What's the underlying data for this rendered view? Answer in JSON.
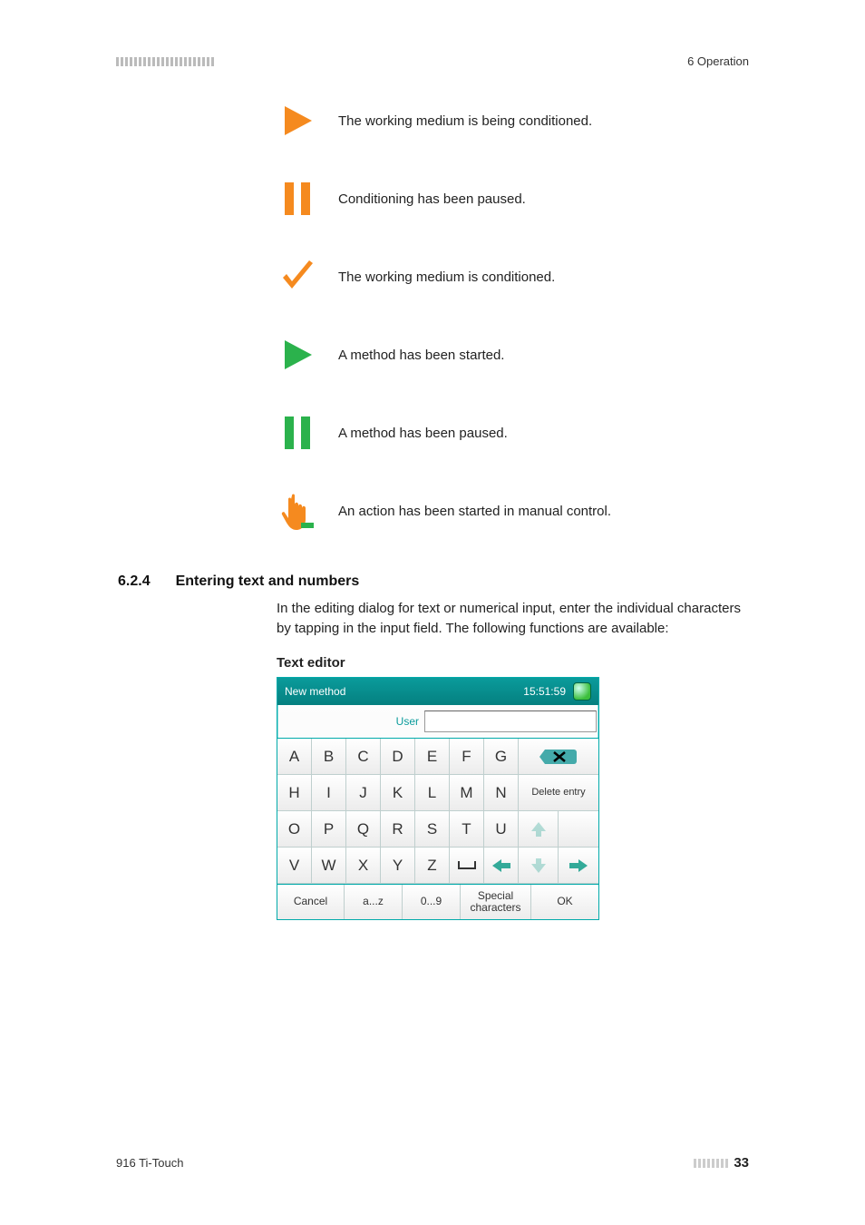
{
  "header": {
    "section_label": "6 Operation"
  },
  "status_items": [
    {
      "icon": "play-orange",
      "text": "The working medium is being conditioned."
    },
    {
      "icon": "pause-orange",
      "text": "Conditioning has been paused."
    },
    {
      "icon": "check-orange",
      "text": "The working medium is conditioned."
    },
    {
      "icon": "play-green",
      "text": "A method has been started."
    },
    {
      "icon": "pause-green",
      "text": "A method has been paused."
    },
    {
      "icon": "hand-orange",
      "text": "An action has been started in manual control."
    }
  ],
  "heading": {
    "number": "6.2.4",
    "title": "Entering text and numbers"
  },
  "body": {
    "paragraph": "In the editing dialog for text or numerical input, enter the individual characters by tapping in the input field. The following functions are available:",
    "subhead": "Text editor"
  },
  "editor": {
    "title": "New method",
    "time": "15:51:59",
    "user_label": "User",
    "user_value": "",
    "rows": [
      [
        "A",
        "B",
        "C",
        "D",
        "E",
        "F",
        "G"
      ],
      [
        "H",
        "I",
        "J",
        "K",
        "L",
        "M",
        "N"
      ],
      [
        "O",
        "P",
        "Q",
        "R",
        "S",
        "T",
        "U"
      ],
      [
        "V",
        "W",
        "X",
        "Y",
        "Z"
      ]
    ],
    "side_buttons": {
      "backspace_name": "backspace-icon",
      "delete_label": "Delete entry",
      "up_name": "arrow-up-icon",
      "down_name": "arrow-down-icon",
      "space_name": "space-icon",
      "left_name": "arrow-left-icon",
      "right_name": "arrow-right-icon"
    },
    "bottom": {
      "cancel": "Cancel",
      "lowercase": "a...z",
      "digits": "0...9",
      "special": "Special characters",
      "ok": "OK"
    }
  },
  "footer": {
    "device": "916 Ti-Touch",
    "page": "33"
  }
}
